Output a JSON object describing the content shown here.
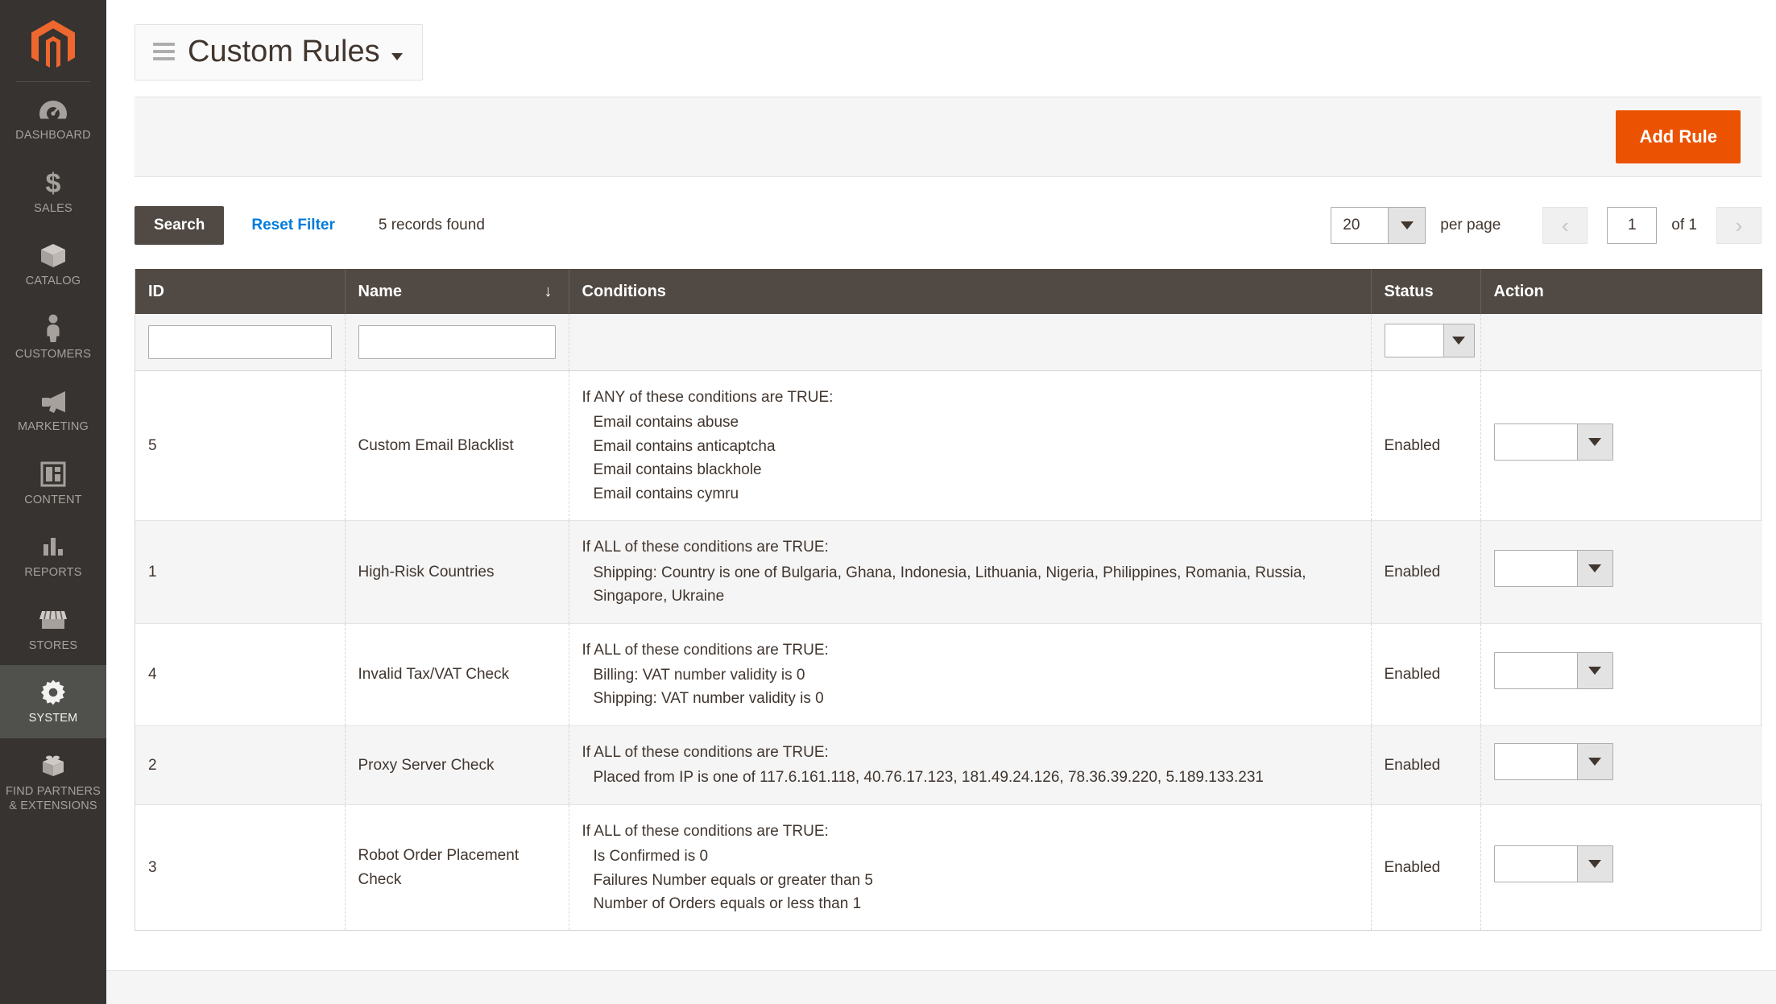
{
  "sidebar": {
    "logo_alt": "magento-logo",
    "items": [
      {
        "label": "DASHBOARD",
        "icon": "dashboard-gauge-icon",
        "active": false
      },
      {
        "label": "SALES",
        "icon": "dollar-sign-icon",
        "active": false
      },
      {
        "label": "CATALOG",
        "icon": "box-icon",
        "active": false
      },
      {
        "label": "CUSTOMERS",
        "icon": "person-icon",
        "active": false
      },
      {
        "label": "MARKETING",
        "icon": "megaphone-icon",
        "active": false
      },
      {
        "label": "CONTENT",
        "icon": "layout-icon",
        "active": false
      },
      {
        "label": "REPORTS",
        "icon": "bar-chart-icon",
        "active": false
      },
      {
        "label": "STORES",
        "icon": "storefront-icon",
        "active": false
      },
      {
        "label": "SYSTEM",
        "icon": "gear-icon",
        "active": true
      },
      {
        "label": "FIND PARTNERS\n& EXTENSIONS",
        "icon": "lego-brick-icon",
        "active": false
      }
    ]
  },
  "header": {
    "title": "Custom Rules",
    "menu_icon": "hamburger-icon",
    "caret_icon": "chevron-down-icon"
  },
  "page_actions": {
    "add_rule_label": "Add Rule",
    "accent_color": "#eb5202"
  },
  "toolbar": {
    "search_label": "Search",
    "reset_filter_label": "Reset Filter",
    "records_found": "5 records found",
    "per_page_value": "20",
    "per_page_label": "per page",
    "prev_icon": "chevron-left-icon",
    "next_icon": "chevron-right-icon",
    "current_page": "1",
    "of_label": "of 1",
    "link_color": "#007bdb"
  },
  "grid": {
    "columns": [
      {
        "key": "id",
        "label": "ID",
        "sorted": false
      },
      {
        "key": "name",
        "label": "Name",
        "sorted": true,
        "sort_dir": "↓"
      },
      {
        "key": "conditions",
        "label": "Conditions",
        "sorted": false
      },
      {
        "key": "status",
        "label": "Status",
        "sorted": false
      },
      {
        "key": "action",
        "label": "Action",
        "sorted": false
      }
    ],
    "filters": {
      "id_value": "",
      "name_value": "",
      "status_value": ""
    },
    "rows": [
      {
        "id": "5",
        "name": "Custom Email Blacklist",
        "cond_head": "If ANY of these conditions are TRUE:",
        "cond_items": [
          "Email contains abuse",
          "Email contains anticaptcha",
          "Email contains blackhole",
          "Email contains cymru"
        ],
        "status": "Enabled",
        "action_value": ""
      },
      {
        "id": "1",
        "name": "High-Risk Countries",
        "cond_head": "If ALL of these conditions are TRUE:",
        "cond_items": [
          "Shipping: Country is one of Bulgaria, Ghana, Indonesia, Lithuania, Nigeria, Philippines, Romania, Russia, Singapore, Ukraine"
        ],
        "status": "Enabled",
        "action_value": ""
      },
      {
        "id": "4",
        "name": "Invalid Tax/VAT Check",
        "cond_head": "If ALL of these conditions are TRUE:",
        "cond_items": [
          "Billing: VAT number validity is 0",
          "Shipping: VAT number validity is 0"
        ],
        "status": "Enabled",
        "action_value": ""
      },
      {
        "id": "2",
        "name": "Proxy Server Check",
        "cond_head": "If ALL of these conditions are TRUE:",
        "cond_items": [
          "Placed from IP is one of 117.6.161.118, 40.76.17.123, 181.49.24.126, 78.36.39.220, 5.189.133.231"
        ],
        "status": "Enabled",
        "action_value": ""
      },
      {
        "id": "3",
        "name": "Robot Order Placement Check",
        "cond_head": "If ALL of these conditions are TRUE:",
        "cond_items": [
          "Is Confirmed is 0",
          "Failures Number equals or greater than 5",
          "Number of Orders equals or less than 1"
        ],
        "status": "Enabled",
        "action_value": ""
      }
    ]
  }
}
